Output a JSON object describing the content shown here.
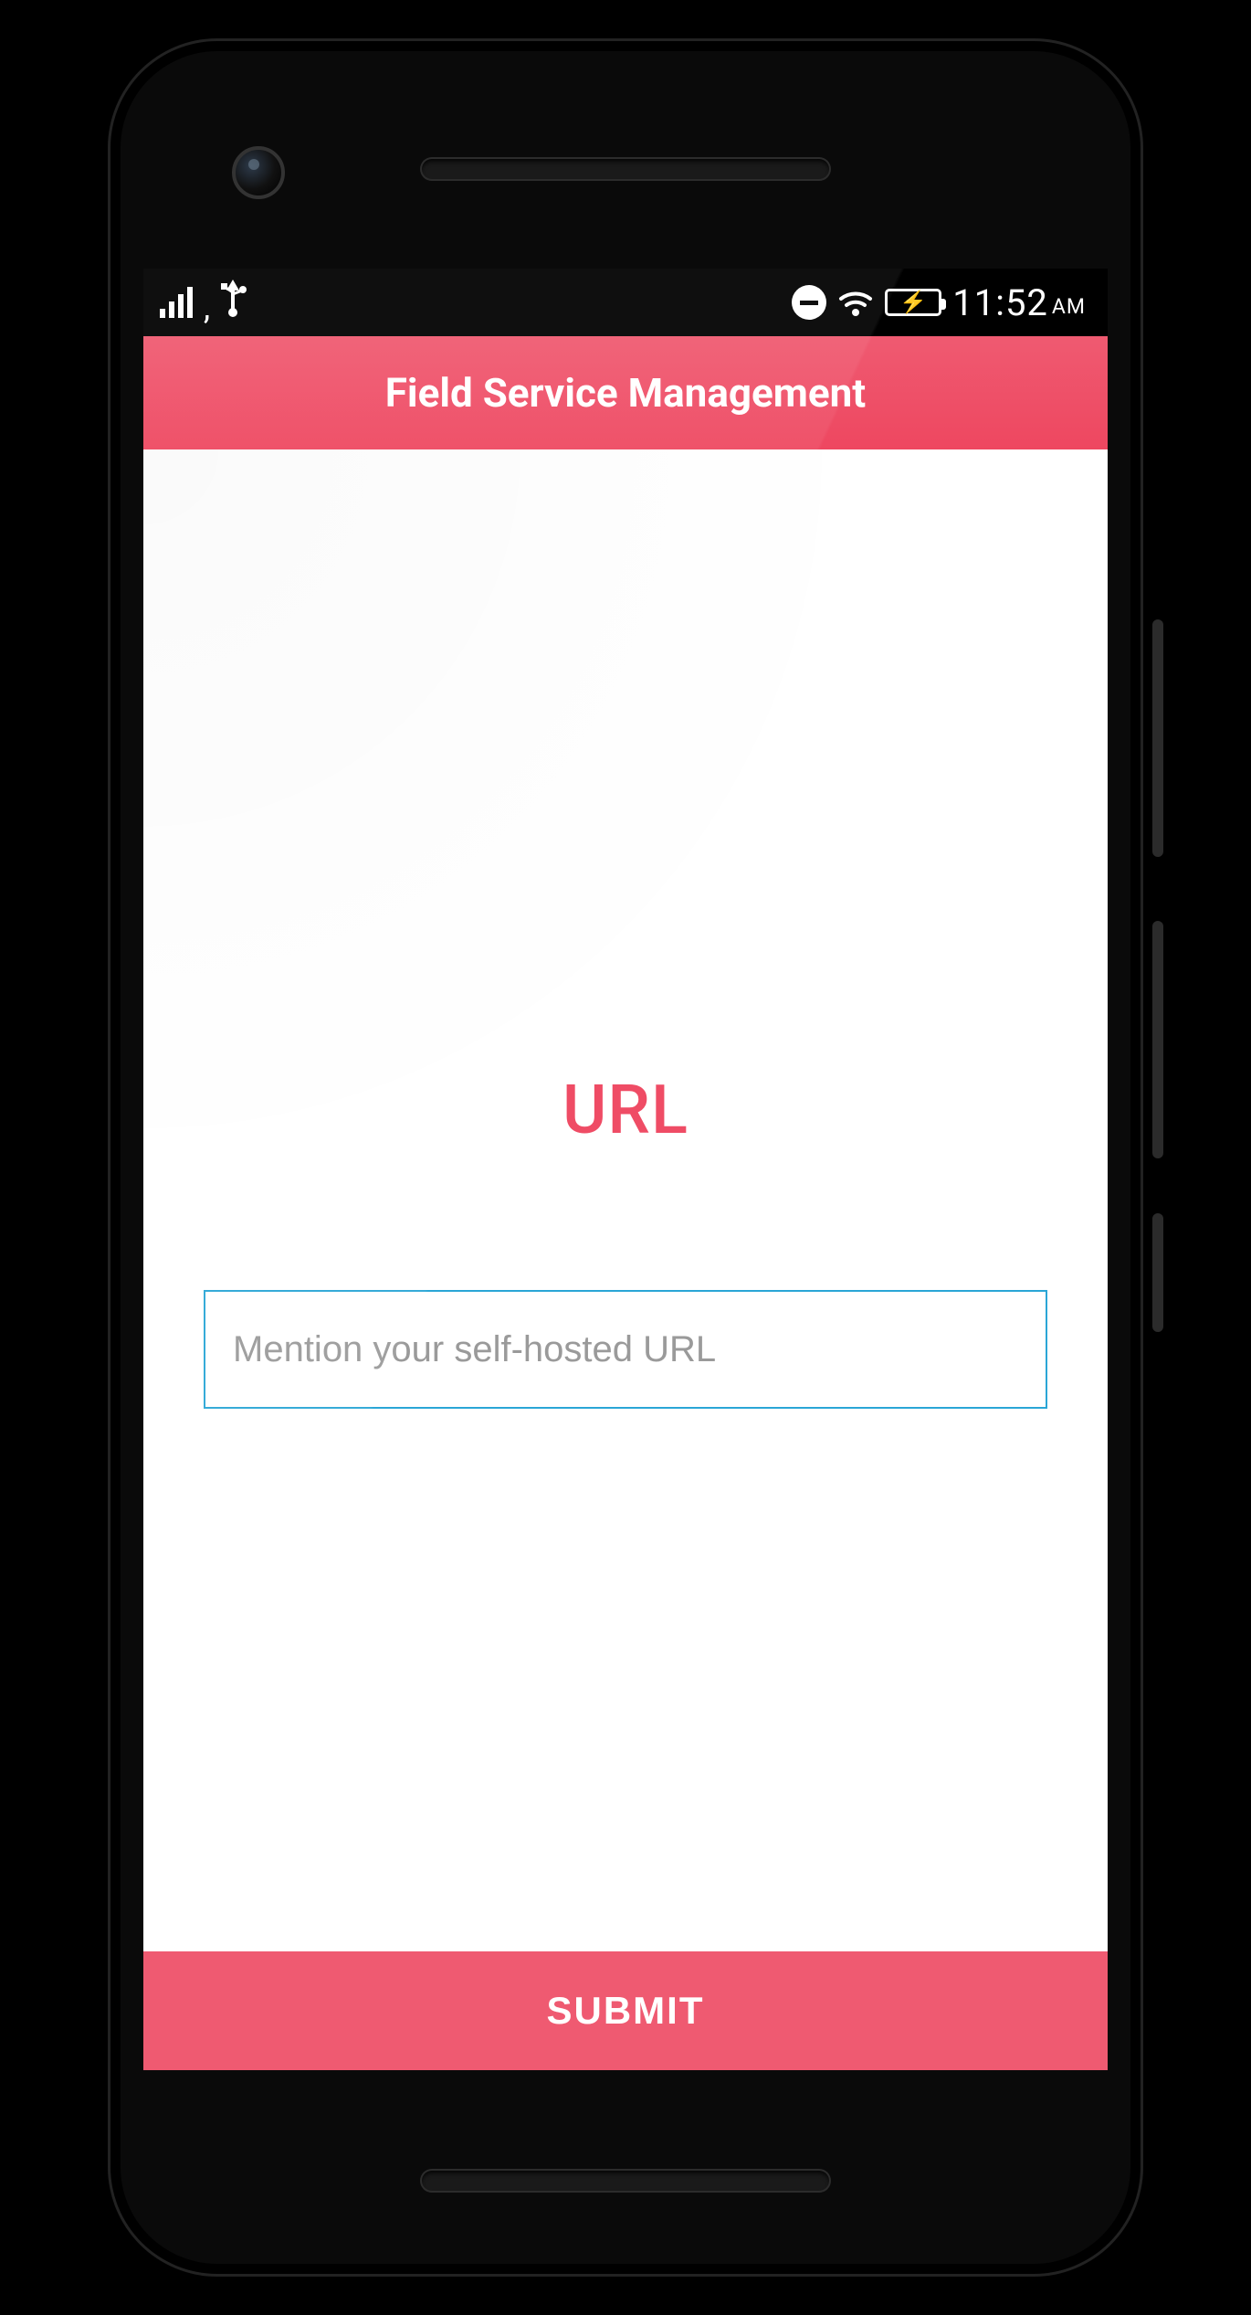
{
  "status_bar": {
    "time": "11:52",
    "ampm": "AM",
    "icons": {
      "signal": "signal-bars-icon",
      "usb": "usb-icon",
      "dnd": "do-not-disturb-icon",
      "wifi": "wifi-icon",
      "battery": "battery-charging-icon"
    }
  },
  "header": {
    "title": "Field Service Management"
  },
  "form": {
    "heading": "URL",
    "url_placeholder": "Mention your self-hosted URL",
    "url_value": "",
    "submit_label": "SUBMIT"
  },
  "colors": {
    "accent": "#ef4c65",
    "header_gradient_top": "#ef5a71",
    "header_gradient_bottom": "#ee4760",
    "input_border": "#2aa6d6"
  }
}
